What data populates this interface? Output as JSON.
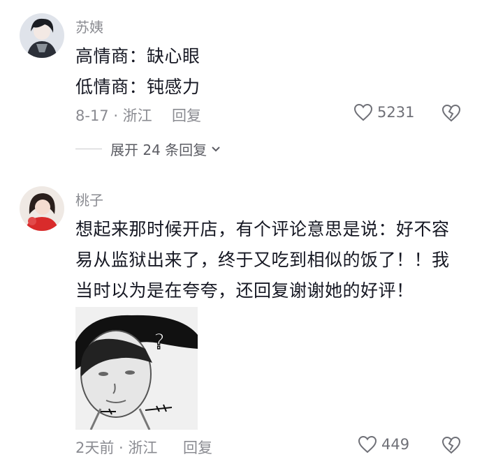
{
  "comments": [
    {
      "username": "苏姨",
      "lines": [
        "高情商：缺心眼",
        "低情商：钝感力"
      ],
      "meta": "8-17 · 浙江",
      "reply": "回复",
      "likes": "5231",
      "expand_label": "展开 24 条回复"
    },
    {
      "username": "桃子",
      "lines": [
        "想起来那时候开店，有个评论意思是说：好不容",
        "易从监狱出来了，终于又吃到相似的饭了！！我",
        "当时以为是在夸夸，还回复谢谢她的好评！"
      ],
      "sticker_glyph": "?",
      "meta": "2天前 · 浙江",
      "reply": "回复",
      "likes": "449"
    }
  ],
  "icons": {
    "like": "heart-outline-icon",
    "dislike": "broken-heart-icon",
    "expand": "chevron-down-icon"
  },
  "colors": {
    "text": "#161823",
    "secondary": "#8a8b91",
    "background": "#ffffff"
  }
}
